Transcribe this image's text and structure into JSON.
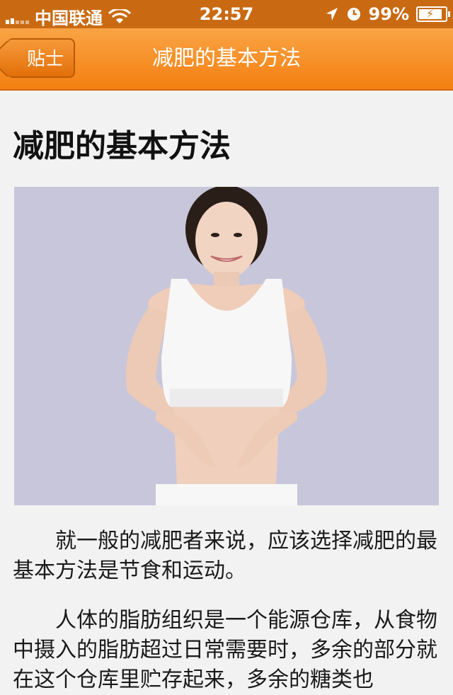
{
  "status_bar": {
    "carrier": "中国联通",
    "time": "22:57",
    "battery": "99%",
    "battery_level": 0.99,
    "icons": [
      "signal-icon",
      "wifi-icon",
      "location-arrow-icon",
      "clock-icon",
      "battery-charging-icon"
    ]
  },
  "nav": {
    "back_label": "贴士",
    "title": "减肥的基本方法"
  },
  "article": {
    "title": "减肥的基本方法",
    "image": "woman-fitness-photo",
    "paragraphs": [
      "就一般的减肥者来说，应该选择减肥的最基本方法是节食和运动。",
      "人体的脂肪组织是一个能源仓库，从食物中摄入的脂肪超过日常需要时，多余的部分就在这个仓库里贮存起来，多余的糖类也"
    ]
  },
  "colors": {
    "nav_orange": "#f47f10",
    "status_bar": "#c96a12",
    "background": "#f2f2f2"
  }
}
